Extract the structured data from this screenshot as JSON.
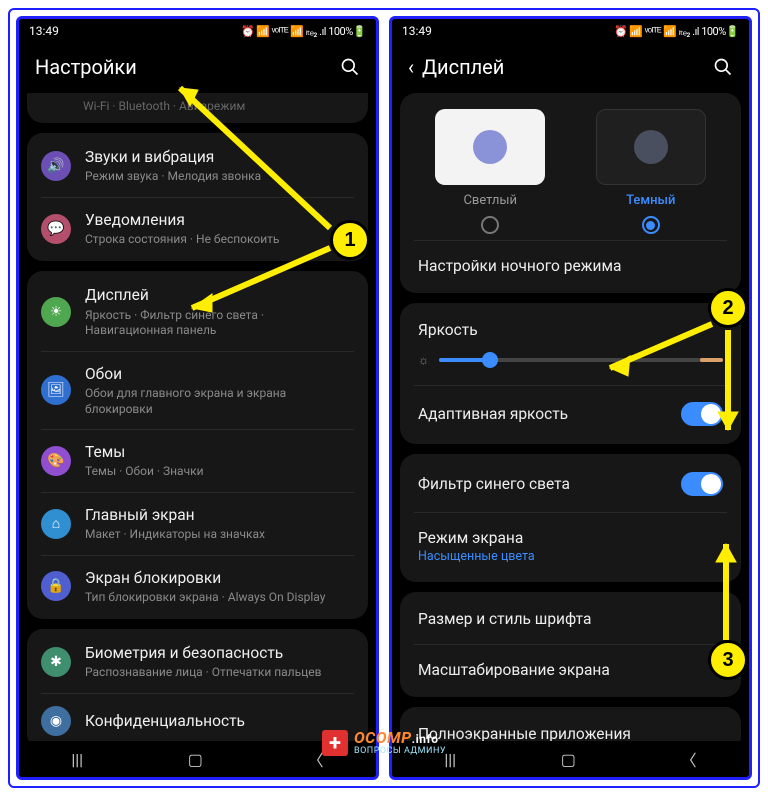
{
  "status": {
    "time": "13:49",
    "icons_text": "⏰ 📶 ᵛᵒᴵᵀᴱ 📶 ₗₜₑ₂ .ıl 100%🔋",
    "battery": "100%"
  },
  "left": {
    "header_title": "Настройки",
    "cut_row": "Wi-Fi  ·  Bluetooth  ·  Авиарежим",
    "items": [
      {
        "icon_bg": "#6b4fb5",
        "glyph": "🔊",
        "title": "Звуки и вибрация",
        "sub": "Режим звука  ·  Мелодия звонка"
      },
      {
        "icon_bg": "#b34f6b",
        "glyph": "💬",
        "title": "Уведомления",
        "sub": "Строка состояния  ·  Не беспокоить"
      }
    ],
    "items2": [
      {
        "icon_bg": "#4fa84f",
        "glyph": "☀",
        "title": "Дисплей",
        "sub": "Яркость  ·  Фильтр синего света  ·  Навигационная панель"
      },
      {
        "icon_bg": "#2f6fd0",
        "glyph": "🖼",
        "title": "Обои",
        "sub": "Обои для главного экрана и экрана блокировки"
      },
      {
        "icon_bg": "#8f4fd0",
        "glyph": "🎨",
        "title": "Темы",
        "sub": "Темы  ·  Обои  ·  Значки"
      },
      {
        "icon_bg": "#2f8fd0",
        "glyph": "⌂",
        "title": "Главный экран",
        "sub": "Макет  ·  Индикаторы на значках"
      },
      {
        "icon_bg": "#4f5fd0",
        "glyph": "🔒",
        "title": "Экран блокировки",
        "sub": "Тип блокировки экрана  ·  Always On Display"
      }
    ],
    "items3": [
      {
        "icon_bg": "#3f8f6f",
        "glyph": "✱",
        "title": "Биометрия и безопасность",
        "sub": "Распознавание лица  ·  Отпечатки пальцев"
      },
      {
        "icon_bg": "#3f6f9f",
        "glyph": "◉",
        "title": "Конфиденциальность",
        "sub": ""
      }
    ]
  },
  "right": {
    "header_title": "Дисплей",
    "theme_light": "Светлый",
    "theme_dark": "Темный",
    "night_mode": "Настройки ночного режима",
    "brightness": "Яркость",
    "adaptive": "Адаптивная яркость",
    "blue_filter": "Фильтр синего света",
    "screen_mode": "Режим экрана",
    "screen_mode_sub": "Насыщенные цвета",
    "font": "Размер и стиль шрифта",
    "zoom": "Масштабирование экрана",
    "fullscreen": "Полноэкранные приложения"
  },
  "annotations": {
    "b1": "1",
    "b2": "2",
    "b3": "3"
  },
  "watermark": {
    "main": "OCOMP",
    "info": ".info",
    "sub": "ВОПРОСЫ АДМИНУ"
  }
}
